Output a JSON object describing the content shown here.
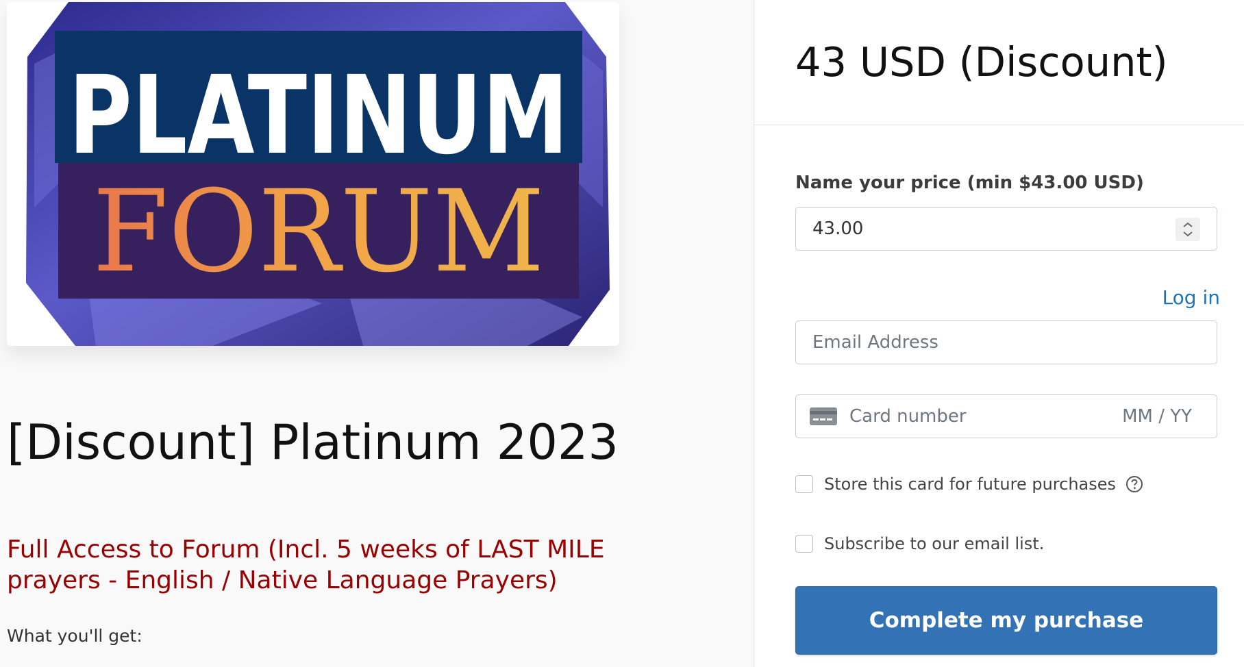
{
  "cover": {
    "logo_line_1": "PLATINUM",
    "logo_line_2": "FORUM"
  },
  "product": {
    "title": "[Discount] Platinum 2023",
    "subtitle": "Full Access to Forum (Incl. 5 weeks of LAST MILE prayers - English / Native Language Prayers)",
    "intro": "What you'll get:"
  },
  "checkout": {
    "price_heading": "43 USD (Discount)",
    "price_label": "Name your price (min $43.00 USD)",
    "price_value": "43.00",
    "login_label": "Log in",
    "email_placeholder": "Email Address",
    "card_number_placeholder": "Card number",
    "card_expiry_placeholder": "MM / YY",
    "store_card_label": "Store this card for future purchases",
    "subscribe_label": "Subscribe to our email list.",
    "submit_label": "Complete my purchase",
    "store_card_checked": false,
    "subscribe_checked": false
  },
  "icons": {
    "stepper": "up-down-stepper-icon",
    "card": "credit-card-icon",
    "help": "question-circle-icon"
  },
  "colors": {
    "accent": "#3372b5",
    "link": "#1f73b7",
    "subtitle": "#990000",
    "logo_orange": "#f0a14a",
    "logo_navy": "#0b3466",
    "logo_purple": "#36205e"
  }
}
